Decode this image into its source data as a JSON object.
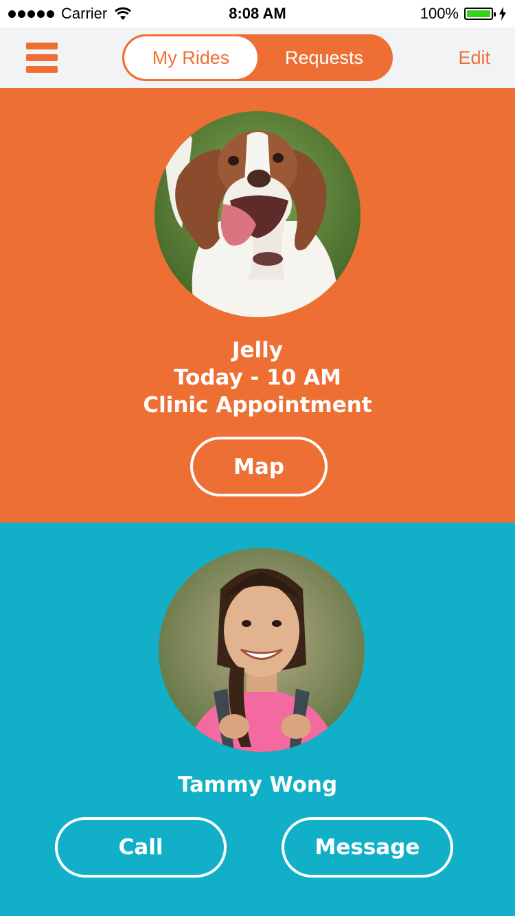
{
  "status_bar": {
    "carrier": "Carrier",
    "time": "8:08 AM",
    "battery": "100%"
  },
  "nav": {
    "tabs": [
      {
        "label": "My Rides",
        "active": true
      },
      {
        "label": "Requests",
        "active": false
      }
    ],
    "edit_label": "Edit",
    "accent_color": "#EE6F33"
  },
  "ride": {
    "name": "Jelly",
    "time": "Today - 10 AM",
    "purpose": "Clinic Appointment",
    "map_label": "Map",
    "background": "#EE6F33"
  },
  "contact": {
    "name": "Tammy Wong",
    "call_label": "Call",
    "message_label": "Message",
    "background": "#12B0C8"
  }
}
